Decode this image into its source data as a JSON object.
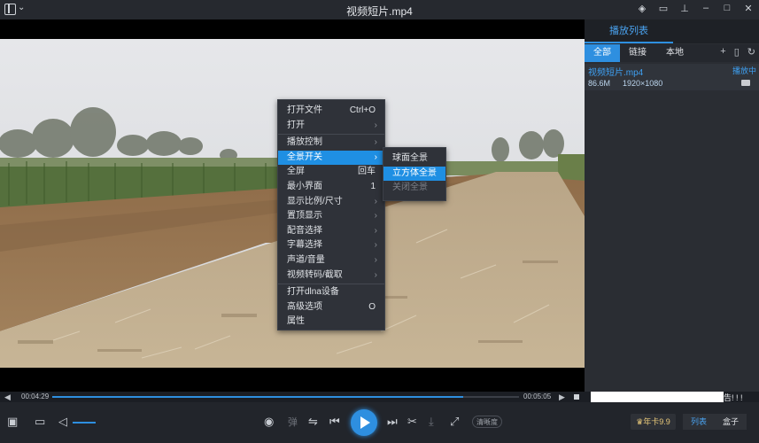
{
  "window": {
    "title": "视频短片.mp4",
    "icons": [
      "logo-icon",
      "chevron-down-icon",
      "skin-icon",
      "message-icon",
      "pin-icon",
      "minimize-icon",
      "maximize-icon",
      "close-icon"
    ]
  },
  "menu": {
    "items": [
      {
        "label": "打开文件",
        "shortcut": "Ctrl+O"
      },
      {
        "label": "打开",
        "arrow": "›"
      },
      {
        "label": "播放控制",
        "arrow": "›"
      },
      {
        "label": "全景开关",
        "arrow": "›"
      },
      {
        "label": "全屏",
        "shortcut": "回车"
      },
      {
        "label": "最小界面",
        "shortcut": "1"
      },
      {
        "label": "显示比例/尺寸",
        "arrow": "›"
      },
      {
        "label": "置顶显示",
        "arrow": "›"
      },
      {
        "label": "配音选择",
        "arrow": "›"
      },
      {
        "label": "字幕选择",
        "arrow": "›"
      },
      {
        "label": "声道/音量",
        "arrow": "›"
      },
      {
        "label": "视频转码/截取",
        "arrow": "›"
      },
      {
        "label": "打开dlna设备"
      },
      {
        "label": "高级选项",
        "shortcut": "O"
      },
      {
        "label": "属性"
      }
    ],
    "submenu": [
      "球面全景",
      "立方体全景",
      "关闭全景"
    ]
  },
  "playlist": {
    "title": "播放列表",
    "tabs": [
      "全部",
      "链接",
      "本地"
    ],
    "entry": {
      "name": "视频短片.mp4",
      "status": "播放中",
      "size": "86.6M",
      "resolution": "1920×1080"
    }
  },
  "player": {
    "current_time": "00:04:29",
    "total_time": "00:05:05",
    "progress": 0.88,
    "ad_suffix": "告! ! !",
    "danmaku_label": "弹",
    "quality_label": "清晰度",
    "vip_label": "年卡9.9",
    "list_button": "列表",
    "box_button": "盒子",
    "accent_color": "#2e8fe0"
  }
}
